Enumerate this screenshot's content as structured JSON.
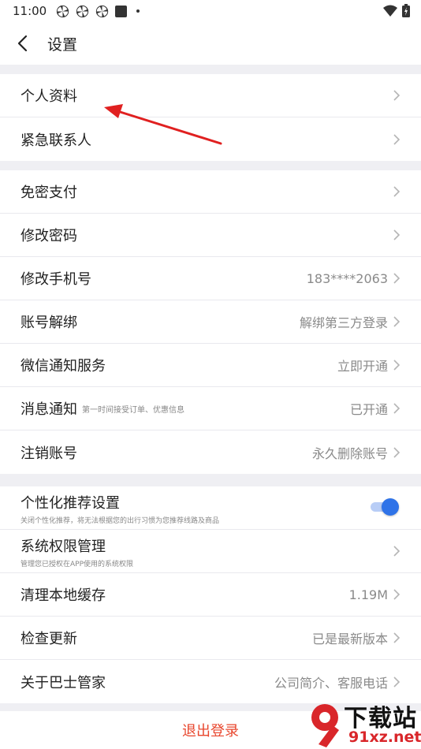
{
  "status": {
    "time": "11:00"
  },
  "header": {
    "title": "设置"
  },
  "groups": [
    {
      "items": [
        {
          "label": "个人资料"
        },
        {
          "label": "紧急联系人"
        }
      ]
    },
    {
      "items": [
        {
          "label": "免密支付",
          "value": ""
        },
        {
          "label": "修改密码",
          "value": ""
        },
        {
          "label": "修改手机号",
          "value": "183****2063"
        },
        {
          "label": "账号解绑",
          "value": "解绑第三方登录"
        },
        {
          "label": "微信通知服务",
          "value": "立即开通"
        },
        {
          "label": "消息通知",
          "sub": "第一时间接受订单、优惠信息",
          "value": "已开通"
        },
        {
          "label": "注销账号",
          "value": "永久删除账号"
        }
      ]
    },
    {
      "items": [
        {
          "label": "个性化推荐设置",
          "sub": "关闭个性化推荐，将无法根据您的出行习惯为您推荐线路及商品",
          "toggle_on": true
        },
        {
          "label": "系统权限管理",
          "sub": "管理您已授权在APP使用的系统权限"
        },
        {
          "label": "清理本地缓存",
          "value": "1.19M"
        },
        {
          "label": "检查更新",
          "value": "已是最新版本"
        },
        {
          "label": "关于巴士管家",
          "value": "公司简介、客服电话"
        }
      ]
    }
  ],
  "logout": {
    "label": "退出登录"
  },
  "annotation": {
    "arrow_color": "#e02020"
  },
  "watermark": {
    "digit": "9",
    "text": "下载站",
    "url": "91xz.net",
    "color": "#d9262a"
  }
}
